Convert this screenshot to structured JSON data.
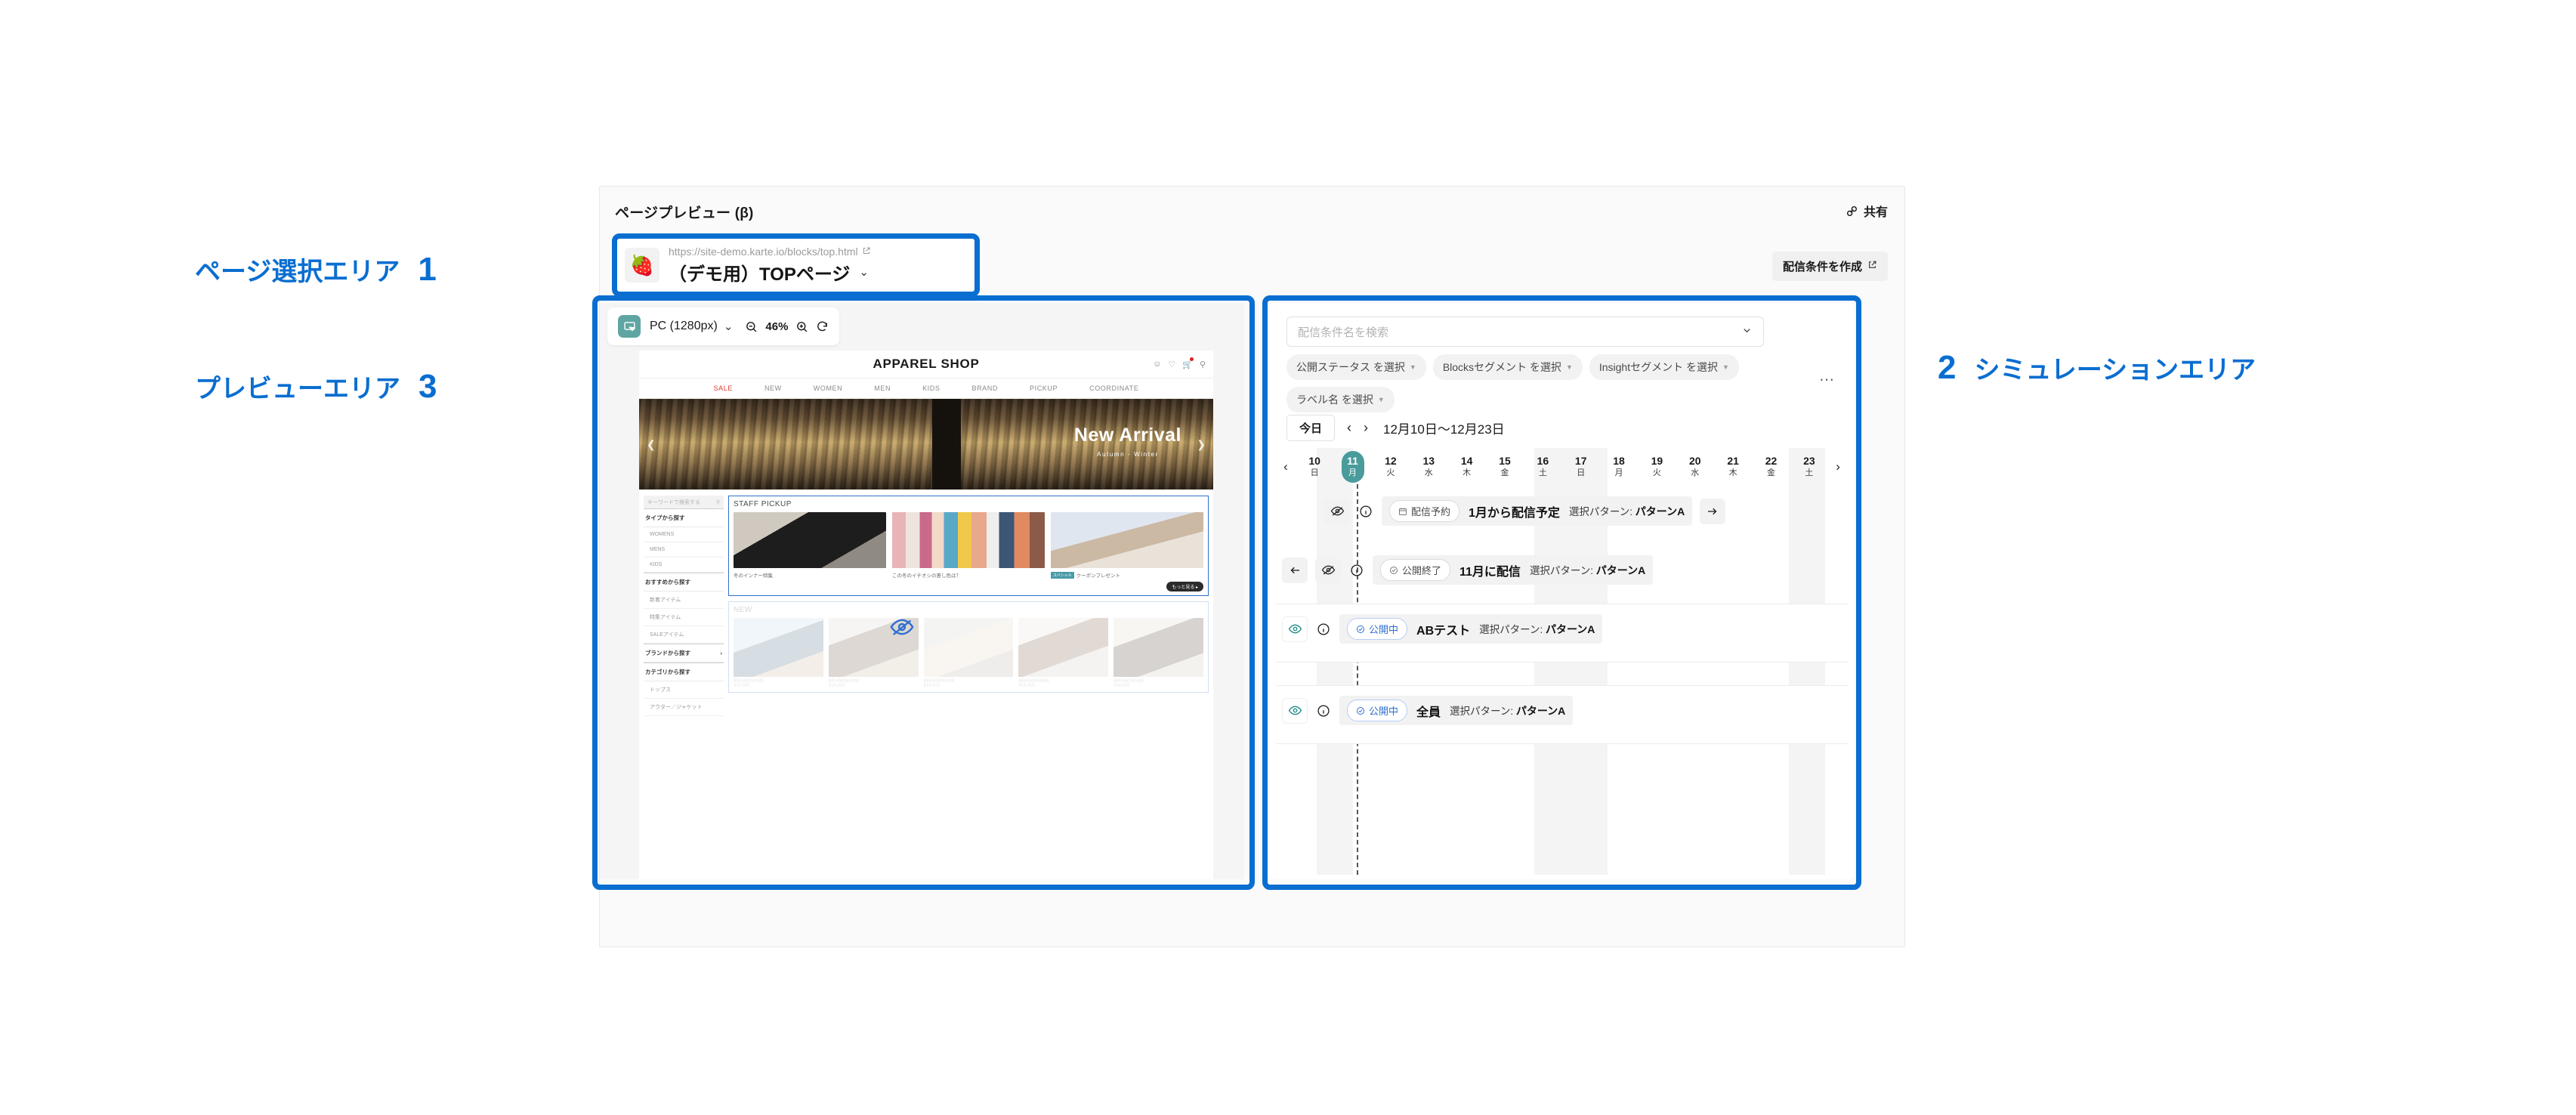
{
  "annotations": [
    {
      "label": "ページ選択エリア",
      "number": "1"
    },
    {
      "label": "プレビューエリア",
      "number": "3"
    },
    {
      "label": "シミュレーションエリア",
      "number": "2"
    }
  ],
  "header": {
    "title": "ページプレビュー (β)",
    "share_label": "共有",
    "share_icon": "link-icon"
  },
  "page_select": {
    "favicon": "🍓",
    "url": "https://site-demo.karte.io/blocks/top.html",
    "external_icon": "external-link-icon",
    "page_name": "（デモ用）TOPページ",
    "chevron": "chevron-down-icon",
    "create_condition_label": "配信条件を作成"
  },
  "preview": {
    "device_icon": "device-select-icon",
    "device_label": "PC (1280px)",
    "zoom_out_icon": "zoom-out-icon",
    "zoom_level": "46%",
    "zoom_in_icon": "zoom-in-icon",
    "refresh_icon": "refresh-icon"
  },
  "site": {
    "brand": "APPAREL SHOP",
    "header_icons": [
      "user-icon",
      "heart-icon",
      "cart-icon",
      "search-icon"
    ],
    "nav": [
      "SALE",
      "NEW",
      "WOMEN",
      "MEN",
      "KIDS",
      "BRAND",
      "PICKUP",
      "COORDINATE"
    ],
    "hero": {
      "title": "New Arrival",
      "subtitle": "Autumn - Winter"
    },
    "sidebar": {
      "search_placeholder": "キーワードで検索する",
      "groups": [
        {
          "heading": "タイプから探す",
          "items": [
            "WOMENS",
            "MENS",
            "KIDS"
          ]
        },
        {
          "heading": "おすすめから探す",
          "items": [
            "新着アイテム",
            "特集アイテム",
            "SALEアイテム"
          ]
        },
        {
          "heading": "ブランドから探す",
          "items": []
        },
        {
          "heading": "カテゴリから探す",
          "items": [
            "トップス",
            "アウター／ジャケット"
          ]
        }
      ]
    },
    "staff_pickup": {
      "title": "STAFF PICKUP",
      "items": [
        {
          "caption": "冬のインナー特集",
          "badge": ""
        },
        {
          "caption": "この冬のイチオシの差し色は？",
          "badge": ""
        },
        {
          "caption": "クーポンプレゼント",
          "badge": "スペシャル"
        }
      ],
      "more_label": "もっと見る ▸"
    },
    "new_section": {
      "title": "NEW",
      "items": [
        {
          "brand": "BRANDNAME",
          "price": "¥18,900"
        },
        {
          "brand": "BRANDNAME",
          "price": "¥18,900"
        },
        {
          "brand": "BRANDNAME",
          "price": "¥18,900"
        },
        {
          "brand": "BRANDNAME",
          "price": "¥18,900"
        },
        {
          "brand": "BRANDNAME",
          "price": "¥18,900"
        }
      ],
      "hidden_icon": "eye-off-icon"
    }
  },
  "simulation": {
    "search_placeholder": "配信条件名を検索",
    "search_chevron": "chevron-down-icon",
    "filters": [
      {
        "label": "公開ステータス を選択"
      },
      {
        "label": "Blocksセグメント を選択"
      },
      {
        "label": "Insightセグメント を選択"
      },
      {
        "label": "ラベル名 を選択"
      }
    ],
    "kebab_icon": "more-options-icon",
    "date_nav": {
      "today_label": "今日",
      "prev_icon": "chevron-left-icon",
      "next_icon": "chevron-right-icon",
      "range": "12月10日〜12月23日"
    },
    "calendar": {
      "prev_icon": "chevron-left-icon",
      "next_icon": "chevron-right-icon",
      "selected_index": 1,
      "days": [
        {
          "num": "10",
          "wk": "日",
          "weekend": true
        },
        {
          "num": "11",
          "wk": "月",
          "weekend": false
        },
        {
          "num": "12",
          "wk": "火",
          "weekend": false
        },
        {
          "num": "13",
          "wk": "水",
          "weekend": false
        },
        {
          "num": "14",
          "wk": "木",
          "weekend": false
        },
        {
          "num": "15",
          "wk": "金",
          "weekend": false
        },
        {
          "num": "16",
          "wk": "土",
          "weekend": true
        },
        {
          "num": "17",
          "wk": "日",
          "weekend": true
        },
        {
          "num": "18",
          "wk": "月",
          "weekend": false
        },
        {
          "num": "19",
          "wk": "火",
          "weekend": false
        },
        {
          "num": "20",
          "wk": "水",
          "weekend": false
        },
        {
          "num": "21",
          "wk": "木",
          "weekend": false
        },
        {
          "num": "22",
          "wk": "金",
          "weekend": false
        },
        {
          "num": "23",
          "wk": "土",
          "weekend": true
        }
      ]
    },
    "rows": [
      {
        "left_arrow": false,
        "visibility_icon": "eye-off-icon",
        "info_icon": "info-icon",
        "status_icon": "calendar-icon",
        "status_label": "配信予約",
        "status_kind": "scheduled",
        "title": "1月から配信予定",
        "pattern_label": "選択パターン:",
        "pattern_value": "パターンA",
        "right_arrow": true,
        "shaded": true
      },
      {
        "left_arrow": true,
        "visibility_icon": "eye-off-icon",
        "info_icon": "info-icon",
        "status_icon": "check-circle-icon",
        "status_label": "公開終了",
        "status_kind": "ended",
        "title": "11月に配信",
        "pattern_label": "選択パターン:",
        "pattern_value": "パターンA",
        "right_arrow": false,
        "shaded": true
      },
      {
        "left_arrow": false,
        "visibility_icon": "eye-on-icon",
        "info_icon": "info-icon",
        "status_icon": "check-circle-icon",
        "status_label": "公開中",
        "status_kind": "live",
        "title": "ABテスト",
        "pattern_label": "選択パターン:",
        "pattern_value": "パターンA",
        "right_arrow": false,
        "shaded": false
      },
      {
        "left_arrow": false,
        "visibility_icon": "eye-on-icon",
        "info_icon": "info-icon",
        "status_icon": "check-circle-icon",
        "status_label": "公開中",
        "status_kind": "live",
        "title": "全員",
        "pattern_label": "選択パターン:",
        "pattern_value": "パターンA",
        "right_arrow": false,
        "shaded": false
      }
    ]
  },
  "colors": {
    "accent_blue": "#0a6ed1",
    "teal": "#4a9b9b",
    "live_blue": "#2f6fd0"
  }
}
